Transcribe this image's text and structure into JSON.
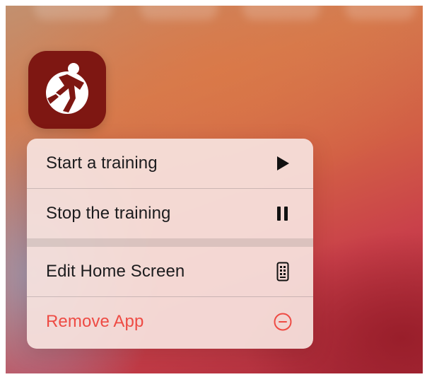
{
  "app": {
    "icon_name": "runner-globe-icon",
    "icon_color": "#7e1712"
  },
  "menu": {
    "items": [
      {
        "label": "Start a training",
        "icon": "play-icon",
        "destructive": false
      },
      {
        "label": "Stop the training",
        "icon": "pause-icon",
        "destructive": false
      },
      {
        "label": "Edit Home Screen",
        "icon": "phone-apps-icon",
        "destructive": false
      },
      {
        "label": "Remove App",
        "icon": "minus-circle-icon",
        "destructive": true
      }
    ]
  },
  "colors": {
    "destructive": "#ee4b44",
    "text": "#1c1c1e",
    "menu_background": "#f6e2de"
  }
}
